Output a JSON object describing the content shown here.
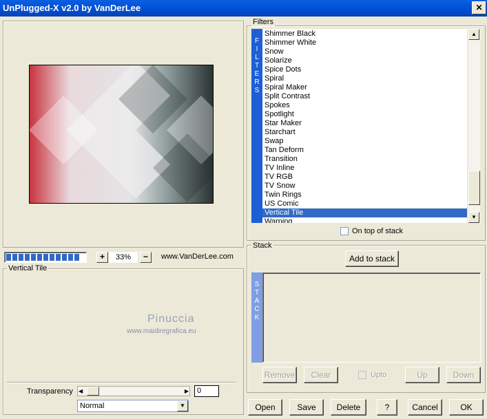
{
  "window": {
    "title": "UnPlugged-X v2.0 by VanDerLee",
    "close_glyph": "✕"
  },
  "preview": {
    "zoom": "33%",
    "website": "www.VanDerLee.com",
    "zoom_in_glyph": "+",
    "zoom_out_glyph": "−",
    "progress_segments": 12
  },
  "filter_panel": {
    "label": "Vertical Tile",
    "watermark_name": "Pinuccia",
    "watermark_url": "www.maidiregrafica.eu",
    "transparency_label": "Transparency",
    "transparency_value": "0",
    "blend_mode": "Normal"
  },
  "filters": {
    "group_label": "Filters",
    "strip_letters": [
      "F",
      "I",
      "L",
      "T",
      "E",
      "R",
      "S"
    ],
    "items": [
      "Shimmer Black",
      "Shimmer White",
      "Snow",
      "Solarize",
      "Spice Dots",
      "Spiral",
      "Spiral Maker",
      "Split Contrast",
      "Spokes",
      "Spotlight",
      "Star Maker",
      "Starchart",
      "Swap",
      "Tan Deform",
      "Transition",
      "TV Inline",
      "TV RGB",
      "TV Snow",
      "Twin Rings",
      "US Comic",
      "Vertical Tile",
      "Warping"
    ],
    "selected": "Vertical Tile",
    "on_top_label": "On top of stack"
  },
  "stack": {
    "group_label": "Stack",
    "add_button": "Add to stack",
    "strip_letters": [
      "S",
      "T",
      "A",
      "C",
      "K"
    ],
    "remove_button": "Remove",
    "clear_button": "Clear",
    "upto_label": "Upto",
    "up_button": "Up",
    "down_button": "Down"
  },
  "footer": {
    "open": "Open",
    "save": "Save",
    "delete": "Delete",
    "help": "?",
    "cancel": "Cancel",
    "ok": "OK"
  },
  "colors": {
    "titlebar": "#0353d8",
    "face": "#ece9d8",
    "strip_blue": "#1c5fd6",
    "strip_stack": "#7f9ee4",
    "selection": "#316ac5"
  }
}
